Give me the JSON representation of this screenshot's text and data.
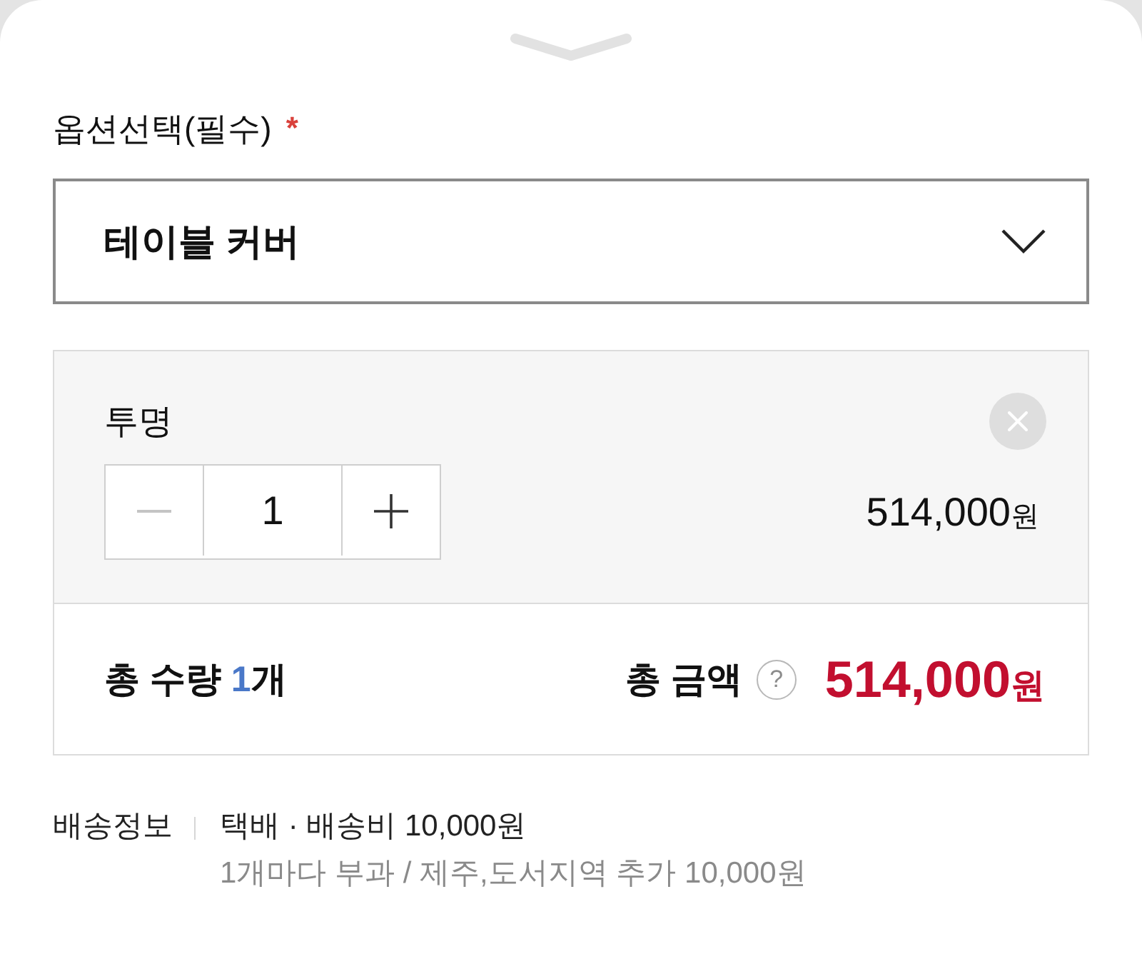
{
  "option_select": {
    "label": "옵션선택(필수)",
    "required_mark": "*",
    "value": "테이블 커버"
  },
  "selected_options": [
    {
      "name": "투명",
      "decrease_disabled": true,
      "quantity": "1",
      "price": "514,000",
      "price_unit": "원"
    }
  ],
  "summary": {
    "quantity_label": "총 수량",
    "quantity_value": "1",
    "quantity_unit": "개",
    "amount_label": "총 금액",
    "help": "?",
    "amount_value": "514,000",
    "amount_unit": "원"
  },
  "shipping": {
    "label": "배송정보",
    "method": "택배 · 배송비 10,000원",
    "note": "1개마다 부과 / 제주,도서지역 추가 10,000원"
  }
}
